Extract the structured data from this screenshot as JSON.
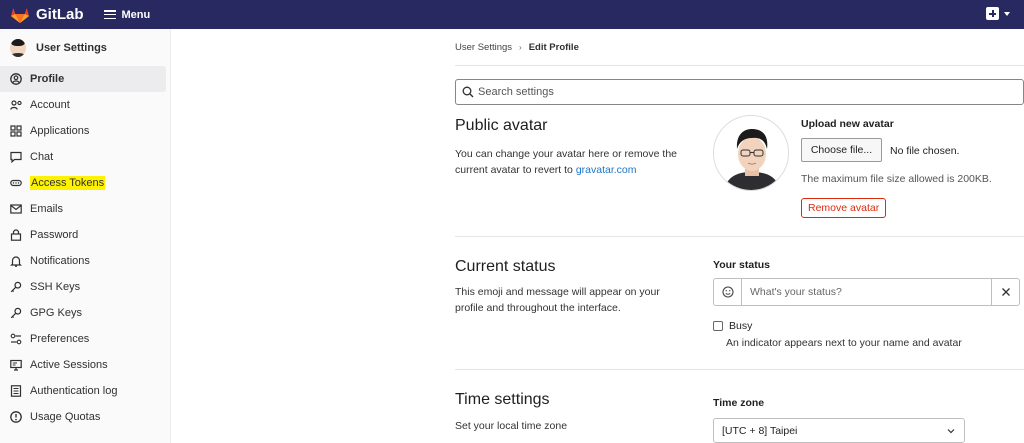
{
  "topbar": {
    "brand": "GitLab",
    "menu_label": "Menu",
    "colors": {
      "background": "#292961",
      "logo": "#e24329"
    }
  },
  "sidebar": {
    "title": "User Settings",
    "items": [
      {
        "label": "Profile",
        "icon": "profile-icon",
        "active": true
      },
      {
        "label": "Account",
        "icon": "account-icon"
      },
      {
        "label": "Applications",
        "icon": "applications-icon"
      },
      {
        "label": "Chat",
        "icon": "chat-icon"
      },
      {
        "label": "Access Tokens",
        "icon": "token-icon",
        "highlighted": true
      },
      {
        "label": "Emails",
        "icon": "mail-icon"
      },
      {
        "label": "Password",
        "icon": "lock-icon"
      },
      {
        "label": "Notifications",
        "icon": "bell-icon"
      },
      {
        "label": "SSH Keys",
        "icon": "key-icon"
      },
      {
        "label": "GPG Keys",
        "icon": "key-icon"
      },
      {
        "label": "Preferences",
        "icon": "preferences-icon"
      },
      {
        "label": "Active Sessions",
        "icon": "monitor-icon"
      },
      {
        "label": "Authentication log",
        "icon": "log-icon"
      },
      {
        "label": "Usage Quotas",
        "icon": "quota-icon"
      }
    ]
  },
  "breadcrumb": {
    "parent": "User Settings",
    "current": "Edit Profile"
  },
  "search": {
    "placeholder": "Search settings"
  },
  "public_avatar": {
    "title": "Public avatar",
    "description": "You can change your avatar here or remove the current avatar to revert to",
    "link_text": "gravatar.com",
    "upload_label": "Upload new avatar",
    "choose_button": "Choose file...",
    "no_file": "No file chosen.",
    "max_size": "The maximum file size allowed is 200KB.",
    "remove_button": "Remove avatar"
  },
  "current_status": {
    "title": "Current status",
    "description": "This emoji and message will appear on your profile and throughout the interface.",
    "field_label": "Your status",
    "placeholder": "What's your status?",
    "busy_label": "Busy",
    "busy_help": "An indicator appears next to your name and avatar"
  },
  "time_settings": {
    "title": "Time settings",
    "description": "Set your local time zone",
    "field_label": "Time zone",
    "selected": "[UTC + 8] Taipei"
  }
}
